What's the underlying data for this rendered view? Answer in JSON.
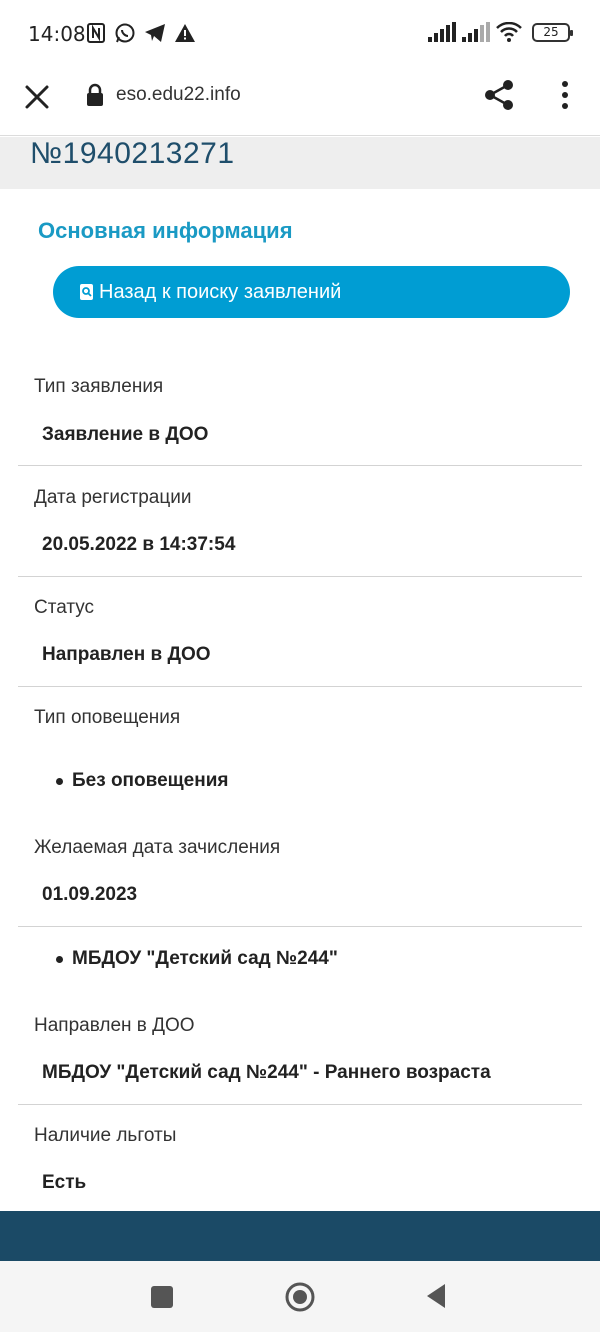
{
  "status_bar": {
    "time": "14:08",
    "battery": "25",
    "left_icons": [
      "nfc-icon",
      "whatsapp-icon",
      "telegram-icon",
      "warning-icon"
    ],
    "right_icons": [
      "signal-icon",
      "signal-icon",
      "wifi-icon",
      "battery-icon"
    ]
  },
  "browser": {
    "url": "eso.edu22.info"
  },
  "page": {
    "app_number": "№1940213271",
    "section_title": "Основная информация",
    "back_button": "Назад к поиску заявлений",
    "fields": {
      "type_label": "Тип заявления",
      "type_value": "Заявление в ДОО",
      "reg_date_label": "Дата регистрации",
      "reg_date_value": "20.05.2022 в 14:37:54",
      "status_label": "Статус",
      "status_value": "Направлен в ДОО",
      "notify_label": "Тип оповещения",
      "notify_value": "Без оповещения",
      "desired_date_label": "Желаемая дата зачисления",
      "desired_date_value": "01.09.2023",
      "preferred_doo": "МБДОУ \"Детский сад №244\"",
      "sent_to_label": "Направлен в ДОО",
      "sent_to_value": "МБДОУ \"Детский сад №244\" - Раннего возраста",
      "benefit_label": "Наличие льготы",
      "benefit_value": "Есть"
    }
  },
  "colors": {
    "accent": "#009dd3",
    "title": "#1a9ac4",
    "number": "#1f4e6b",
    "footer": "#1b4a66"
  }
}
